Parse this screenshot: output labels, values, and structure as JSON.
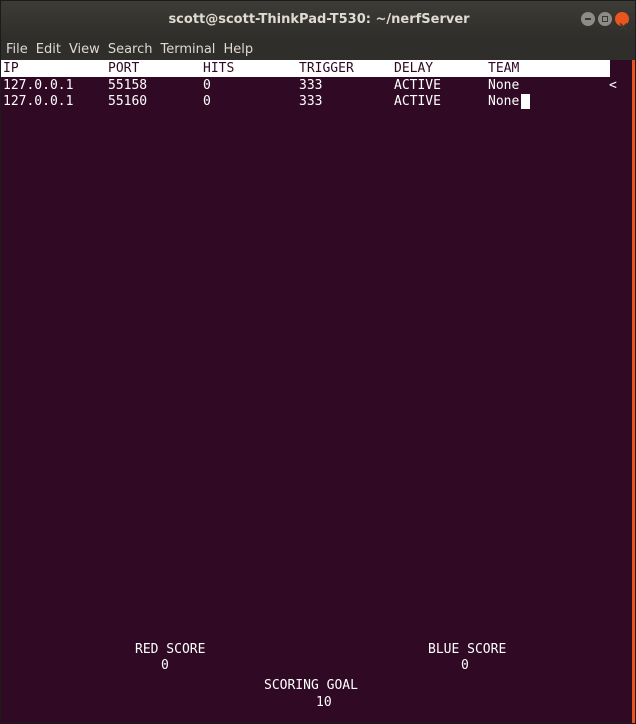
{
  "window": {
    "title": "scott@scott-ThinkPad-T530: ~/nerfServer"
  },
  "menu": [
    "File",
    "Edit",
    "View",
    "Search",
    "Terminal",
    "Help"
  ],
  "table": {
    "columns": [
      "IP",
      "PORT",
      "HITS",
      "TRIGGER",
      "DELAY",
      "TEAM"
    ],
    "rows": [
      [
        "127.0.0.1",
        "55158",
        "0",
        "333",
        "ACTIVE",
        "None"
      ],
      [
        "127.0.0.1",
        "55160",
        "0",
        "333",
        "ACTIVE",
        "None"
      ]
    ],
    "selection_marker": "<"
  },
  "scores": {
    "red_label": "RED SCORE",
    "red_value": "0",
    "blue_label": "BLUE SCORE",
    "blue_value": "0",
    "goal_label": "SCORING GOAL",
    "goal_value": "10"
  },
  "colors": {
    "terminal_bg": "#300a24",
    "titlebar_bg": "#2f2e2a",
    "accent_orange": "#e9541f",
    "text": "#ffffff"
  }
}
